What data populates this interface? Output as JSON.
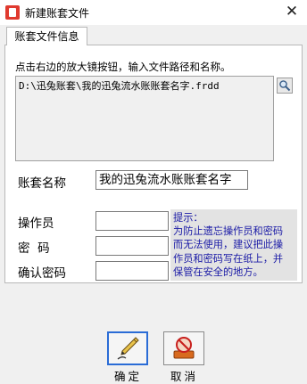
{
  "window": {
    "title": "新建账套文件",
    "close_label": "✕"
  },
  "tab": {
    "label": "账套文件信息"
  },
  "file": {
    "hint": "点击右边的放大镜按钮，输入文件路径和名称。",
    "path": "D:\\迅兔账套\\我的迅兔流水账账套名字.frdd"
  },
  "form": {
    "account_name_label": "账套名称",
    "account_name_value": "我的迅兔流水账账套名字",
    "operator_label": "操作员",
    "password_label": "密  码",
    "confirm_password_label": "确认密码",
    "operator_value": "",
    "password_value": "",
    "confirm_password_value": ""
  },
  "tip": {
    "lines": [
      "提示：",
      "为防止遗忘操作员和密码",
      "而无法使用，建议把此操",
      "作员和密码写在纸上，并",
      "保管在安全的地方。"
    ]
  },
  "buttons": {
    "ok_label": "确定",
    "cancel_label": "取消",
    "ok_icon": "pen-nib-icon",
    "cancel_icon": "cancel-stamp-icon"
  },
  "colors": {
    "tip_text": "#1a1aa6",
    "tip_background": "#e3e3e3",
    "ok_focus_border": "#2a6cd6"
  }
}
